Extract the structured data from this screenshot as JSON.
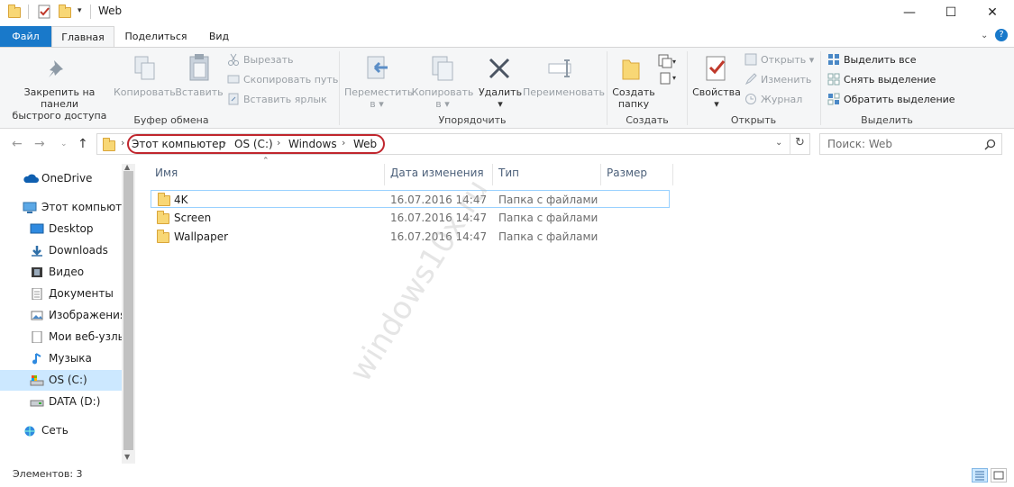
{
  "window": {
    "title": "Web",
    "controls": {
      "minimize": "—",
      "maximize": "☐",
      "close": "✕"
    }
  },
  "tabs": [
    {
      "label": "Файл"
    },
    {
      "label": "Главная"
    },
    {
      "label": "Поделиться"
    },
    {
      "label": "Вид"
    }
  ],
  "ribbon": {
    "clipboard": {
      "pin": "Закрепить на панели\nбыстрого доступа",
      "copy": "Копировать",
      "paste": "Вставить",
      "cut": "Вырезать",
      "copy_path": "Скопировать путь",
      "paste_shortcut": "Вставить ярлык",
      "group": "Буфер обмена"
    },
    "organize": {
      "move": "Переместить\nв ▾",
      "copy_to": "Копировать\nв ▾",
      "delete": "Удалить\n▾",
      "rename": "Переименовать",
      "group": "Упорядочить"
    },
    "create": {
      "new_folder": "Создать\nпапку",
      "group": "Создать"
    },
    "open": {
      "properties": "Свойства\n▾",
      "open": "Открыть",
      "edit": "Изменить",
      "history": "Журнал",
      "group": "Открыть"
    },
    "select": {
      "select_all": "Выделить все",
      "select_none": "Снять выделение",
      "invert": "Обратить выделение",
      "group": "Выделить"
    }
  },
  "address": {
    "crumbs": [
      "Этот компьютер",
      "OS (C:)",
      "Windows",
      "Web"
    ],
    "search_placeholder": "Поиск: Web"
  },
  "nav": [
    {
      "label": "OneDrive"
    },
    {
      "label": "Этот компьютер"
    },
    {
      "label": "Desktop"
    },
    {
      "label": "Downloads"
    },
    {
      "label": "Видео"
    },
    {
      "label": "Документы"
    },
    {
      "label": "Изображения"
    },
    {
      "label": "Мои веб-узлы"
    },
    {
      "label": "Музыка"
    },
    {
      "label": "OS (C:)"
    },
    {
      "label": "DATA (D:)"
    },
    {
      "label": "Сеть"
    }
  ],
  "columns": [
    "Имя",
    "Дата изменения",
    "Тип",
    "Размер"
  ],
  "files": [
    {
      "name": "4K",
      "date": "16.07.2016 14:47",
      "type": "Папка с файлами",
      "size": ""
    },
    {
      "name": "Screen",
      "date": "16.07.2016 14:47",
      "type": "Папка с файлами",
      "size": ""
    },
    {
      "name": "Wallpaper",
      "date": "16.07.2016 14:47",
      "type": "Папка с файлами",
      "size": ""
    }
  ],
  "status": {
    "items": "Элементов: 3"
  },
  "watermark": "windows10x.ru"
}
